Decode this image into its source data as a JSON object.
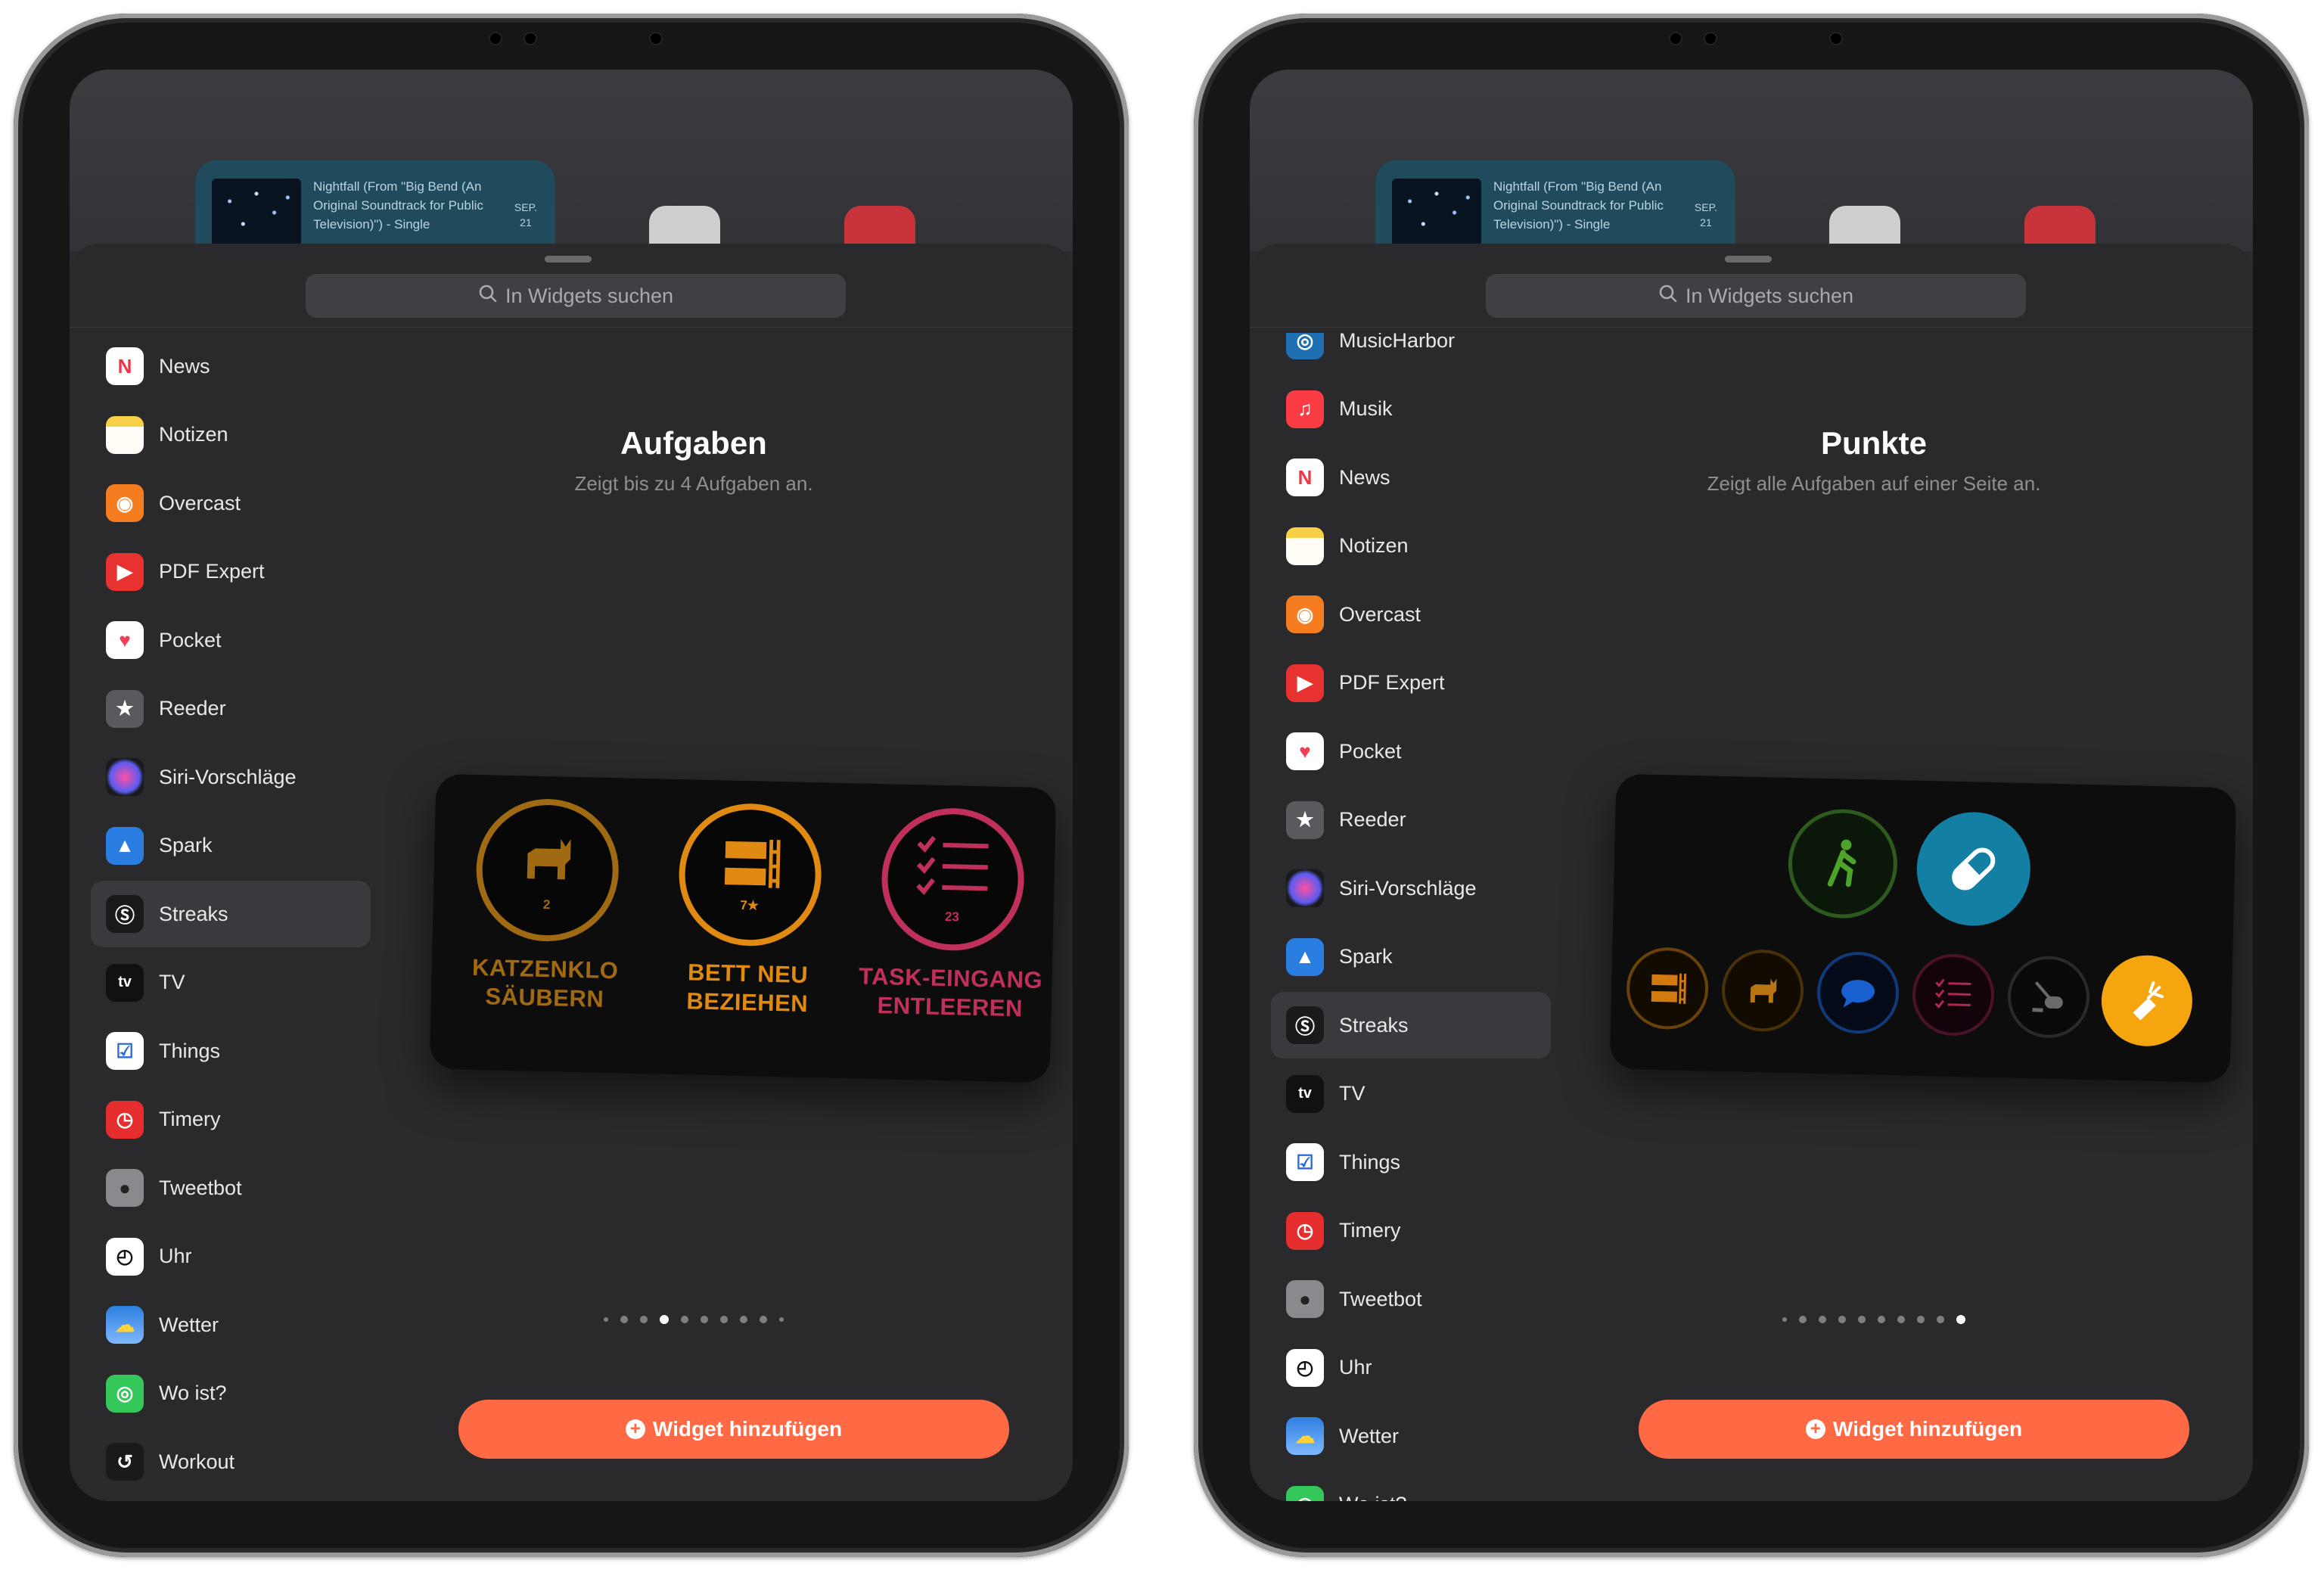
{
  "colors": {
    "accent": "#ff6a45",
    "sheet": "#2a2a2d",
    "selected_row": "#3a3a3e"
  },
  "background": {
    "music_widget_text": "Nightfall (From \"Big Bend (An Original Soundtrack for Public Television)\") - Single",
    "music_widget_month": "SEP.",
    "music_widget_day": "21"
  },
  "left": {
    "search_placeholder": "In Widgets suchen",
    "apps": [
      {
        "label": "News",
        "icon": "news-icon"
      },
      {
        "label": "Notizen",
        "icon": "notes-icon"
      },
      {
        "label": "Overcast",
        "icon": "overcast-icon"
      },
      {
        "label": "PDF Expert",
        "icon": "pdf-expert-icon"
      },
      {
        "label": "Pocket",
        "icon": "pocket-icon"
      },
      {
        "label": "Reeder",
        "icon": "reeder-icon"
      },
      {
        "label": "Siri-Vorschläge",
        "icon": "siri-icon"
      },
      {
        "label": "Spark",
        "icon": "spark-icon"
      },
      {
        "label": "Streaks",
        "icon": "streaks-icon",
        "selected": true
      },
      {
        "label": "TV",
        "icon": "tv-icon"
      },
      {
        "label": "Things",
        "icon": "things-icon"
      },
      {
        "label": "Timery",
        "icon": "timery-icon"
      },
      {
        "label": "Tweetbot",
        "icon": "tweetbot-icon"
      },
      {
        "label": "Uhr",
        "icon": "clock-icon"
      },
      {
        "label": "Wetter",
        "icon": "weather-icon"
      },
      {
        "label": "Wo ist?",
        "icon": "findmy-icon"
      },
      {
        "label": "Workout",
        "icon": "workout-icon"
      }
    ],
    "widget_title": "Aufgaben",
    "widget_subtitle": "Zeigt bis zu 4 Aufgaben an.",
    "tasks": [
      {
        "name": "KATZENKLO SÄUBERN",
        "count": "2",
        "color": "#a06a12",
        "icon": "cat-icon"
      },
      {
        "name": "BETT NEU BEZIEHEN",
        "count": "7★",
        "color": "#e08a12",
        "icon": "bunk-bed-icon"
      },
      {
        "name": "TASK-EINGANG ENTLEEREN",
        "count": "23",
        "color": "#c0305a",
        "icon": "checklist-icon"
      }
    ],
    "page_count": 10,
    "page_active": 3,
    "add_button": "Widget hinzufügen"
  },
  "right": {
    "search_placeholder": "In Widgets suchen",
    "apps": [
      {
        "label": "MusicHarbor",
        "icon": "musicharbor-icon"
      },
      {
        "label": "Musik",
        "icon": "music-icon"
      },
      {
        "label": "News",
        "icon": "news-icon"
      },
      {
        "label": "Notizen",
        "icon": "notes-icon"
      },
      {
        "label": "Overcast",
        "icon": "overcast-icon"
      },
      {
        "label": "PDF Expert",
        "icon": "pdf-expert-icon"
      },
      {
        "label": "Pocket",
        "icon": "pocket-icon"
      },
      {
        "label": "Reeder",
        "icon": "reeder-icon"
      },
      {
        "label": "Siri-Vorschläge",
        "icon": "siri-icon"
      },
      {
        "label": "Spark",
        "icon": "spark-icon"
      },
      {
        "label": "Streaks",
        "icon": "streaks-icon",
        "selected": true
      },
      {
        "label": "TV",
        "icon": "tv-icon"
      },
      {
        "label": "Things",
        "icon": "things-icon"
      },
      {
        "label": "Timery",
        "icon": "timery-icon"
      },
      {
        "label": "Tweetbot",
        "icon": "tweetbot-icon"
      },
      {
        "label": "Uhr",
        "icon": "clock-icon"
      },
      {
        "label": "Wetter",
        "icon": "weather-icon"
      },
      {
        "label": "Wo ist?",
        "icon": "findmy-icon"
      }
    ],
    "widget_title": "Punkte",
    "widget_subtitle": "Zeigt alle Aufgaben auf einer Seite an.",
    "page_count": 10,
    "page_active": 9,
    "add_button": "Widget hinzufügen"
  }
}
